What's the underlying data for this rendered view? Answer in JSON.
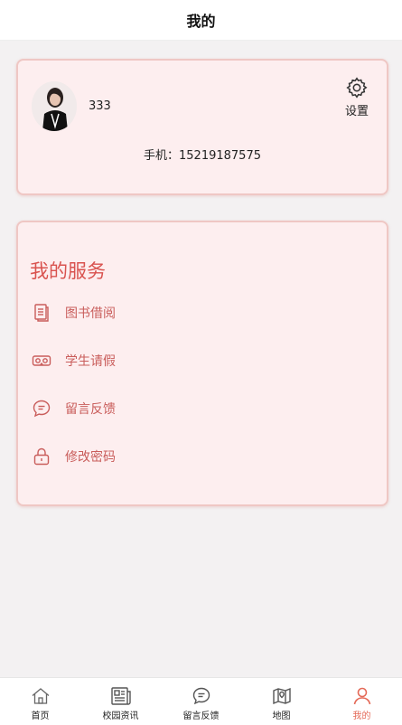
{
  "header": {
    "title": "我的"
  },
  "profile": {
    "username": "333",
    "phone": "手机：15219187575",
    "settings_label": "设置"
  },
  "services": {
    "title": "我的服务",
    "items": [
      {
        "label": "图书借阅",
        "icon": "book-list-icon"
      },
      {
        "label": "学生请假",
        "icon": "vr-glasses-icon"
      },
      {
        "label": "留言反馈",
        "icon": "chat-bubble-icon"
      },
      {
        "label": "修改密码",
        "icon": "lock-icon"
      }
    ]
  },
  "tabbar": {
    "items": [
      {
        "label": "首页",
        "icon": "home-icon"
      },
      {
        "label": "校园资讯",
        "icon": "newspaper-icon"
      },
      {
        "label": "留言反馈",
        "icon": "chat-icon"
      },
      {
        "label": "地图",
        "icon": "map-icon"
      },
      {
        "label": "我的",
        "icon": "user-icon",
        "active": true
      }
    ]
  },
  "colors": {
    "accent": "#d9534f",
    "card_bg": "#fdeeef",
    "card_border": "#efc7c4",
    "active_tab": "#e46a58"
  }
}
